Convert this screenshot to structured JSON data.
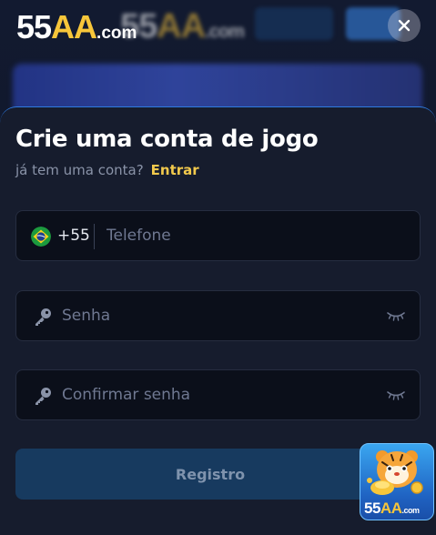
{
  "brand": {
    "num": "55",
    "letters": "AA",
    "domain": ".com"
  },
  "header": {
    "close_icon": "close-icon"
  },
  "form": {
    "title": "Crie uma conta de jogo",
    "have_account_text": "já tem uma conta?",
    "login_link": "Entrar",
    "phone": {
      "country_icon": "brazil-flag-icon",
      "country_code": "+55",
      "placeholder": "Telefone",
      "value": ""
    },
    "password": {
      "icon": "key-icon",
      "placeholder": "Senha",
      "value": "",
      "toggle_icon": "eye-closed-icon"
    },
    "confirm_password": {
      "icon": "key-icon",
      "placeholder": "Confirmar senha",
      "value": "",
      "toggle_icon": "eye-closed-icon"
    },
    "submit_label": "Registro"
  },
  "promo_badge": {
    "icon": "tiger-mascot-icon",
    "brand_num": "55",
    "brand_letters": "AA",
    "brand_domain": ".com"
  },
  "colors": {
    "accent": "#f2c94c",
    "sheet_border": "#2e7be0",
    "submit_bg": "#173a5f",
    "sheet_bg": "#161c2d"
  }
}
